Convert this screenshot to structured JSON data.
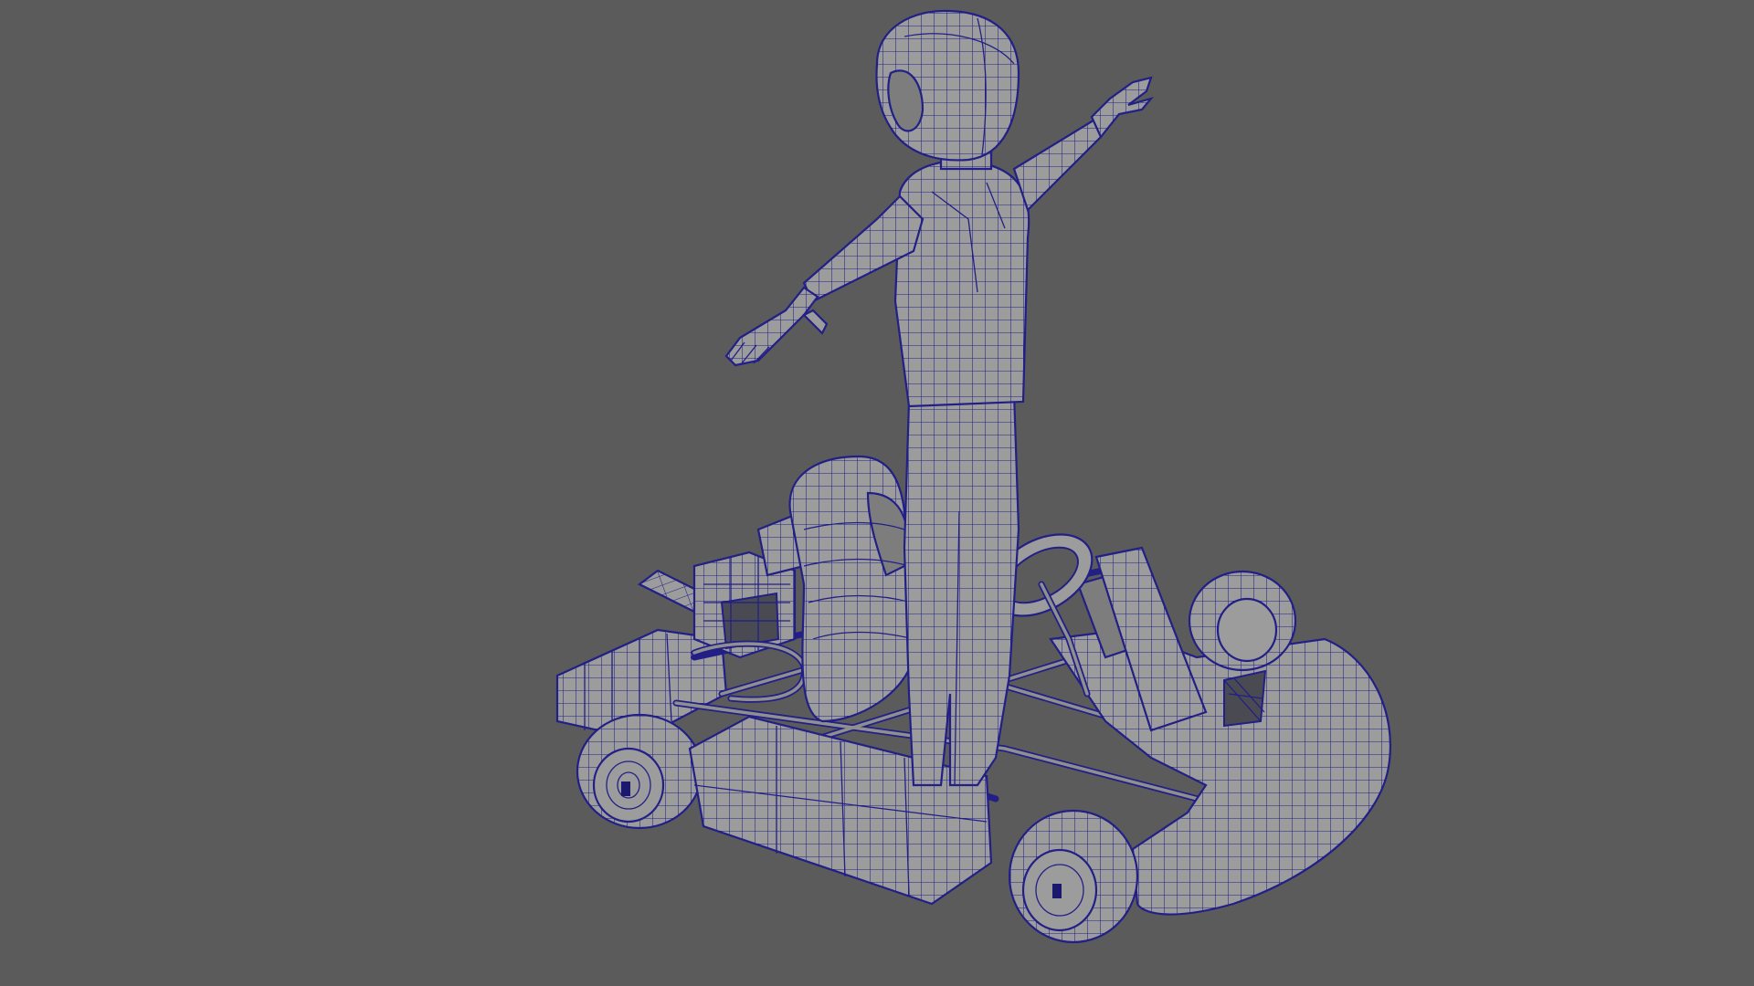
{
  "viewport": {
    "background_color": "#5b5b5b",
    "mesh_fill_color": "#9c9c9c",
    "wireframe_color": "#221f86",
    "display_mode": "wireframe-on-shaded"
  },
  "scene": {
    "objects": [
      {
        "name": "character",
        "pose": "T-pose"
      },
      {
        "name": "go-kart"
      }
    ]
  }
}
